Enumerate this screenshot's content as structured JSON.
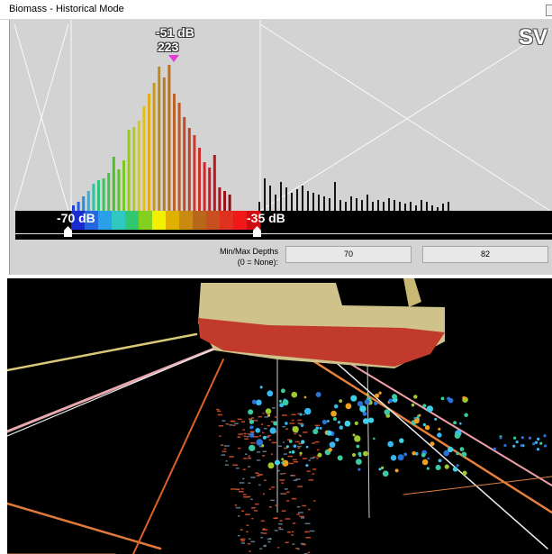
{
  "window": {
    "title": "Biomass - Historical Mode"
  },
  "histogram": {
    "mode_label": "SV",
    "peak": {
      "db_label": "-51 dB",
      "count_label": "223"
    },
    "range": {
      "min_label": "-70 dB",
      "max_label": "-35 dB"
    },
    "colors": {
      "bar_dark": "#141414",
      "colorbar_bg": "#000000",
      "peak_marker": "#e53cd8"
    },
    "bars_colored": [
      {
        "h": 6,
        "c": "#1f3fd6"
      },
      {
        "h": 10,
        "c": "#2262e0"
      },
      {
        "h": 16,
        "c": "#2b8ae6"
      },
      {
        "h": 22,
        "c": "#2fb0d8"
      },
      {
        "h": 30,
        "c": "#2fc3a5"
      },
      {
        "h": 34,
        "c": "#2fc47c"
      },
      {
        "h": 36,
        "c": "#3ac45e"
      },
      {
        "h": 42,
        "c": "#46c244"
      },
      {
        "h": 60,
        "c": "#4cc02e"
      },
      {
        "h": 46,
        "c": "#5ec22a"
      },
      {
        "h": 56,
        "c": "#7cc625"
      },
      {
        "h": 90,
        "c": "#98c820"
      },
      {
        "h": 93,
        "c": "#b4ca1c"
      },
      {
        "h": 100,
        "c": "#d0cc18"
      },
      {
        "h": 116,
        "c": "#e2c018"
      },
      {
        "h": 130,
        "c": "#e0ae1a"
      },
      {
        "h": 142,
        "c": "#cc981c"
      },
      {
        "h": 160,
        "c": "#c08820"
      },
      {
        "h": 148,
        "c": "#b87c22"
      },
      {
        "h": 162,
        "c": "#b87026"
      },
      {
        "h": 130,
        "c": "#b8642a"
      },
      {
        "h": 120,
        "c": "#ba5a2c"
      },
      {
        "h": 104,
        "c": "#bc4e2c"
      },
      {
        "h": 92,
        "c": "#c0442c"
      },
      {
        "h": 84,
        "c": "#c63a2c"
      },
      {
        "h": 70,
        "c": "#cc302a"
      },
      {
        "h": 54,
        "c": "#d02828"
      },
      {
        "h": 48,
        "c": "#c81e24"
      },
      {
        "h": 62,
        "c": "#b81820"
      },
      {
        "h": 26,
        "c": "#a8141c"
      },
      {
        "h": 22,
        "c": "#98121a"
      },
      {
        "h": 18,
        "c": "#881018"
      }
    ],
    "bars_dark": [
      10,
      36,
      28,
      18,
      32,
      26,
      20,
      24,
      28,
      22,
      20,
      18,
      16,
      14,
      32,
      12,
      10,
      16,
      14,
      12,
      18,
      10,
      12,
      10,
      14,
      12,
      10,
      8,
      10,
      6,
      12,
      10,
      6,
      4,
      8,
      10
    ],
    "colorbar_stops": [
      "#1a2bd0",
      "#2468e0",
      "#2aa0e8",
      "#30c8c0",
      "#32c870",
      "#84d020",
      "#f0f000",
      "#e0b000",
      "#c88a10",
      "#b86818",
      "#c85020",
      "#e03020",
      "#f01818",
      "#d00c10"
    ]
  },
  "depth": {
    "label_line1": "Min/Max Depths",
    "label_line2": "(0 = None):",
    "min_value": "70",
    "max_value": "82"
  },
  "scene": {
    "colors": {
      "hull": "#c23a2c",
      "deck": "#cfc28a",
      "school": "#e0532b",
      "targets": [
        "#38b8f0",
        "#2a74d8",
        "#3cc8a0",
        "#a0c830",
        "#f0a020",
        "#40d0e8"
      ]
    }
  }
}
